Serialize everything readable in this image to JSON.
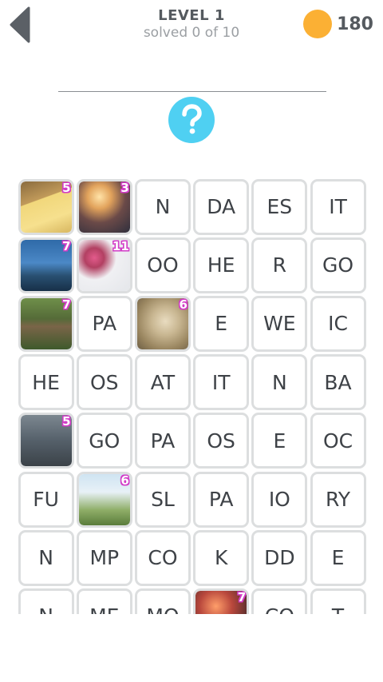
{
  "header": {
    "level_title": "LEVEL 1",
    "solved_text": "solved 0 of 10",
    "coins": "180"
  },
  "colors": {
    "coin": "#fbb034",
    "hint": "#4fd0f2",
    "badge_outline": "#d23cc7",
    "cell_border": "#dcdedf"
  },
  "hint": {
    "icon": "question-mark-icon",
    "label": "?"
  },
  "grid": {
    "cells": [
      {
        "type": "image",
        "img": "cheese",
        "badge": "5"
      },
      {
        "type": "image",
        "img": "party",
        "badge": "3"
      },
      {
        "type": "text",
        "text": "N"
      },
      {
        "type": "text",
        "text": "DA"
      },
      {
        "type": "text",
        "text": "ES"
      },
      {
        "type": "text",
        "text": "IT"
      },
      {
        "type": "image",
        "img": "building",
        "badge": "7"
      },
      {
        "type": "image",
        "img": "flowers",
        "badge": "11"
      },
      {
        "type": "text",
        "text": "OO"
      },
      {
        "type": "text",
        "text": "HE"
      },
      {
        "type": "text",
        "text": "R"
      },
      {
        "type": "text",
        "text": "GO"
      },
      {
        "type": "image",
        "img": "fence",
        "badge": "7"
      },
      {
        "type": "text",
        "text": "PA"
      },
      {
        "type": "image",
        "img": "head",
        "badge": "6"
      },
      {
        "type": "text",
        "text": "E"
      },
      {
        "type": "text",
        "text": "WE"
      },
      {
        "type": "text",
        "text": "IC"
      },
      {
        "type": "text",
        "text": "HE"
      },
      {
        "type": "text",
        "text": "OS"
      },
      {
        "type": "text",
        "text": "AT"
      },
      {
        "type": "text",
        "text": "IT"
      },
      {
        "type": "text",
        "text": "N"
      },
      {
        "type": "text",
        "text": "BA"
      },
      {
        "type": "image",
        "img": "goose",
        "badge": "5"
      },
      {
        "type": "text",
        "text": "GO"
      },
      {
        "type": "text",
        "text": "PA"
      },
      {
        "type": "text",
        "text": "OS"
      },
      {
        "type": "text",
        "text": "E"
      },
      {
        "type": "text",
        "text": "OC"
      },
      {
        "type": "text",
        "text": "FU"
      },
      {
        "type": "image",
        "img": "pagoda",
        "badge": "6"
      },
      {
        "type": "text",
        "text": "SL"
      },
      {
        "type": "text",
        "text": "PA"
      },
      {
        "type": "text",
        "text": "IO"
      },
      {
        "type": "text",
        "text": "RY"
      },
      {
        "type": "text",
        "text": "N"
      },
      {
        "type": "text",
        "text": "MP"
      },
      {
        "type": "text",
        "text": "CO"
      },
      {
        "type": "text",
        "text": "K"
      },
      {
        "type": "text",
        "text": "DD"
      },
      {
        "type": "text",
        "text": "E"
      },
      {
        "type": "text",
        "text": "N"
      },
      {
        "type": "text",
        "text": "ME"
      },
      {
        "type": "text",
        "text": "MO"
      },
      {
        "type": "image",
        "img": "lights",
        "badge": "7"
      },
      {
        "type": "text",
        "text": "CO"
      },
      {
        "type": "text",
        "text": "T"
      }
    ]
  }
}
